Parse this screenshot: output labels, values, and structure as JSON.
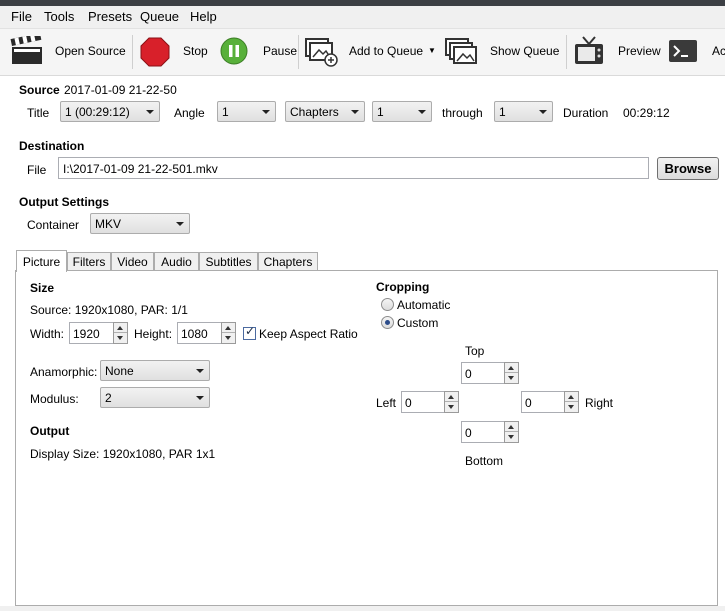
{
  "menu": {
    "items": [
      "File",
      "Tools",
      "Presets",
      "Queue",
      "Help"
    ]
  },
  "toolbar": {
    "open_source": "Open Source",
    "stop": "Stop",
    "pause": "Pause",
    "add_to_queue": "Add to Queue",
    "show_queue": "Show Queue",
    "preview": "Preview",
    "activity_truncated": "Ac"
  },
  "source": {
    "label": "Source",
    "name": "2017-01-09 21-22-50",
    "title_label": "Title",
    "title_value": "1 (00:29:12)",
    "angle_label": "Angle",
    "angle_value": "1",
    "range_type": "Chapters",
    "range_start": "1",
    "through_label": "through",
    "range_end": "1",
    "duration_label": "Duration",
    "duration_value": "00:29:12"
  },
  "destination": {
    "label": "Destination",
    "file_label": "File",
    "file_value": "I:\\2017-01-09 21-22-501.mkv",
    "browse_label": "Browse"
  },
  "output_settings": {
    "label": "Output Settings",
    "container_label": "Container",
    "container_value": "MKV"
  },
  "tabs": [
    "Picture",
    "Filters",
    "Video",
    "Audio",
    "Subtitles",
    "Chapters"
  ],
  "active_tab": "Picture",
  "picture": {
    "size_heading": "Size",
    "source_text": "Source:  1920x1080, PAR: 1/1",
    "width_label": "Width:",
    "width_value": "1920",
    "height_label": "Height:",
    "height_value": "1080",
    "keep_aspect_label": "Keep Aspect Ratio",
    "keep_aspect_checked": true,
    "anamorphic_label": "Anamorphic:",
    "anamorphic_value": "None",
    "modulus_label": "Modulus:",
    "modulus_value": "2",
    "output_heading": "Output",
    "display_size_text": "Display Size: 1920x1080,  PAR 1x1"
  },
  "cropping": {
    "heading": "Cropping",
    "automatic_label": "Automatic",
    "custom_label": "Custom",
    "selected": "Custom",
    "top_label": "Top",
    "top_value": "0",
    "left_label": "Left",
    "left_value": "0",
    "right_label": "Right",
    "right_value": "0",
    "bottom_label": "Bottom",
    "bottom_value": "0"
  },
  "colors": {
    "stop_red": "#d8202a",
    "pause_green": "#58b03a",
    "menu_bg": "#f0f0f0"
  }
}
